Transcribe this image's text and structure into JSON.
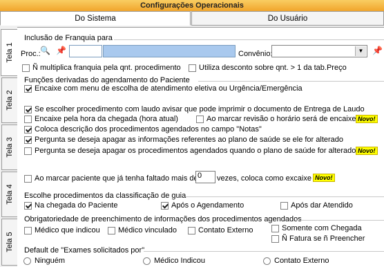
{
  "window": {
    "title": "Configurações Operacionais"
  },
  "tabs": {
    "sistema": "Do Sistema",
    "usuario": "Do Usuário"
  },
  "side_tabs": [
    "Tela 1",
    "Tela 2",
    "Tela 3",
    "Tela 4",
    "Tela 5"
  ],
  "franquia": {
    "title": "Inclusão de Franquia para",
    "proc_label": "Proc.:",
    "proc_code": "",
    "proc_name": "",
    "convenio_label": "Convênio:",
    "convenio_value": "",
    "opt1": "Ñ multiplica franquia pela qnt. procedimento",
    "opt2": "Utiliza desconto sobre qnt. > 1 da tab.Preço"
  },
  "agendamento": {
    "title": "Funções derivadas do agendamento do Paciente",
    "items": [
      "Encaixe com menu de escolha de atendimento eletiva ou Urgência/Emergência",
      "Se escolher procedimento com laudo avisar que pode imprimir o documento de Entrega de Laudo",
      "Encaixe pela hora da chegada (hora atual)",
      "Ao marcar revisão o horário será de encaixe",
      "Coloca descrição dos procedimentos agendados no campo \"Notas\"",
      "Pergunta se deseja apagar as informações referentes ao plano de saúde se ele for alterado",
      "Pergunta se deseja apagar os procedimentos agendados quando o plano de saúde for alterado"
    ],
    "novo": "Novo!",
    "faltado_prefix": "Ao marcar paciente que já tenha faltado mais de",
    "faltado_value": "0",
    "faltado_suffix": "vezes, coloca como excaixe"
  },
  "guia": {
    "title": "Escolhe procedimentos da classificação de guia",
    "items": [
      "Na chegada do Paciente",
      "Após o Agendamento",
      "Após dar Atendido"
    ]
  },
  "obrigatoriedade": {
    "title": "Obrigatoriedade de preenchimento de informações dos procedimentos agendados",
    "items": [
      "Médico que indicou",
      "Médico vinculado",
      "Contato Externo",
      "Somente com Chegada",
      "Ñ Fatura se ñ Preencher"
    ]
  },
  "exames": {
    "title": "Default de \"Exames solicitados por\"",
    "items": [
      "Ninguém",
      "Médico Indicou",
      "Contato Externo"
    ]
  }
}
